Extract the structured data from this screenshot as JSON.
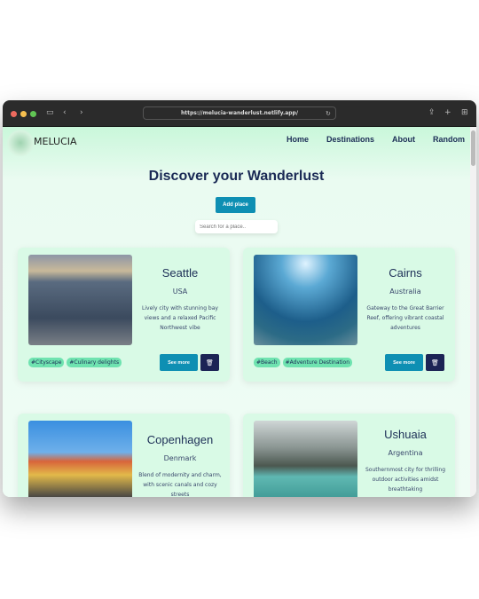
{
  "browser": {
    "url": "https://melucia-wanderlust.netlify.app/"
  },
  "header": {
    "brand": "MELUCIA",
    "nav": [
      "Home",
      "Destinations",
      "About",
      "Random"
    ]
  },
  "main": {
    "title": "Discover your Wanderlust",
    "add_label": "Add place",
    "search_placeholder": "Search for a place..",
    "cards": [
      {
        "name": "Seattle",
        "country": "USA",
        "desc": "Lively city with stunning bay views and a relaxed Pacific Northwest vibe",
        "tags": [
          "#Cityscape",
          "#Culinary delights"
        ]
      },
      {
        "name": "Cairns",
        "country": "Australia",
        "desc": "Gateway to the Great Barrier Reef, offering vibrant coastal adventures",
        "tags": [
          "#Beach",
          "#Adventure Destination"
        ]
      },
      {
        "name": "Copenhagen",
        "country": "Denmark",
        "desc": "Blend of modernity and charm, with scenic canals and cozy streets",
        "tags": []
      },
      {
        "name": "Ushuaia",
        "country": "Argentina",
        "desc": "Southernmost city for thrilling outdoor activities amidst breathtaking",
        "tags": []
      }
    ],
    "see_more_label": "See more",
    "delete_icon": "trash-icon"
  },
  "colors": {
    "accent": "#0e8fb3",
    "dark": "#1c2355",
    "card": "#d9fae6",
    "tag": "#6fe3b0"
  }
}
